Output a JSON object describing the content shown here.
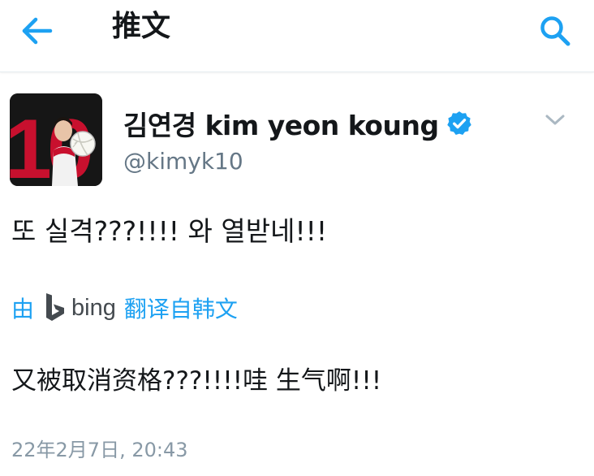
{
  "header": {
    "title": "推文",
    "back_icon": "arrow-left-icon",
    "search_icon": "search-icon"
  },
  "tweet": {
    "avatar_jersey_number": "10",
    "display_name": "김연경 kim yeon koung",
    "handle": "@kimyk10",
    "verified": true,
    "text": "또 실격???!!!! 와 열받네!!!",
    "translate": {
      "prefix": "由",
      "provider": "bing",
      "suffix": "翻译自韩文"
    },
    "translated_text": "又被取消资格???!!!!哇 生气啊!!!",
    "timestamp": "22年2月7日, 20:43"
  },
  "colors": {
    "accent": "#1da1f2",
    "text_primary": "#14171a",
    "text_secondary": "#657786",
    "bing_gray": "#444a4f",
    "avatar_red": "#c8102e"
  }
}
